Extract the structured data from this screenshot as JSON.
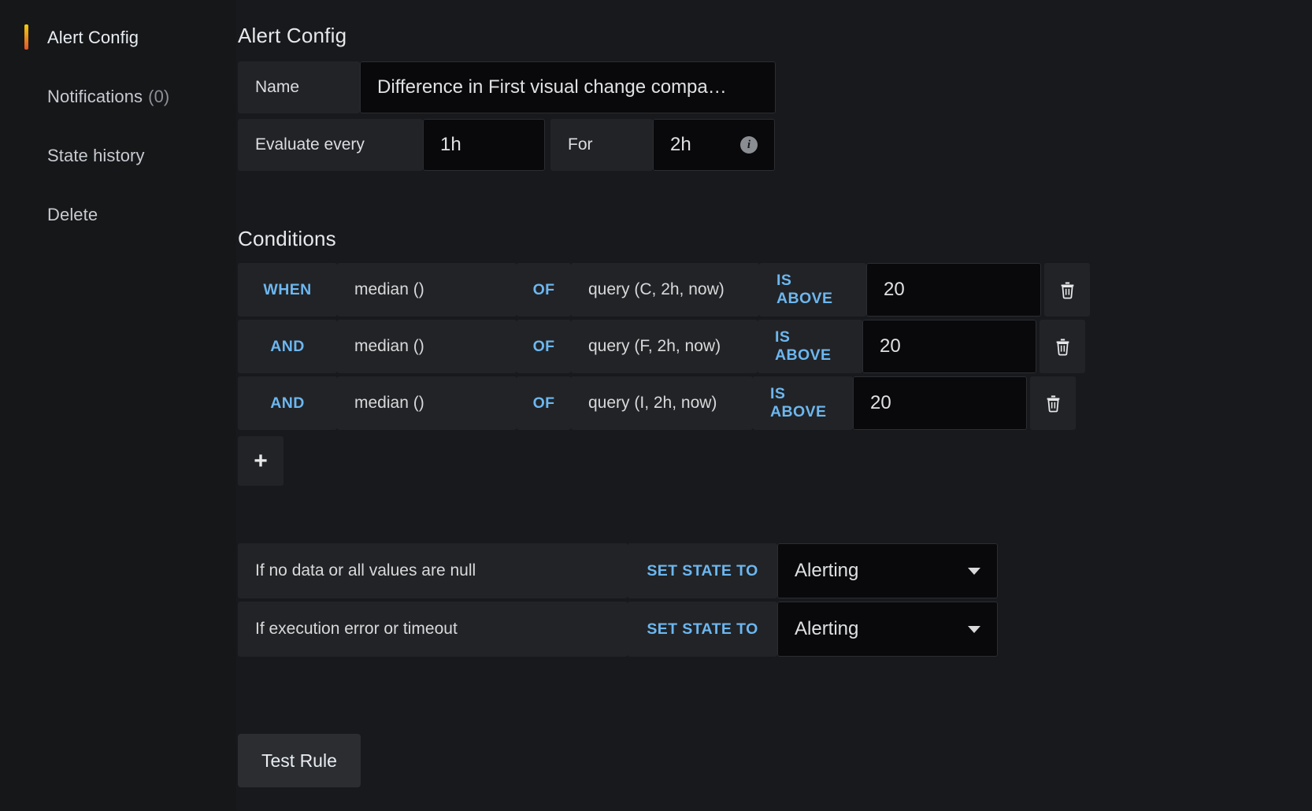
{
  "sidebar": {
    "items": [
      {
        "label": "Alert Config",
        "count": "",
        "active": true
      },
      {
        "label": "Notifications",
        "count": "(0)",
        "active": false
      },
      {
        "label": "State history",
        "count": "",
        "active": false
      },
      {
        "label": "Delete",
        "count": "",
        "active": false
      }
    ]
  },
  "alert_config": {
    "title": "Alert Config",
    "name_label": "Name",
    "name_value": "Difference in First visual change compa…",
    "evaluate_label": "Evaluate every",
    "evaluate_value": "1h",
    "for_label": "For",
    "for_value": "2h",
    "for_info_icon": "info-icon",
    "for_info_glyph": "i"
  },
  "conditions": {
    "title": "Conditions",
    "add_label": "+",
    "delete_icon": "trash-icon",
    "rows": [
      {
        "operator": "WHEN",
        "reducer": "median ()",
        "of": "OF",
        "query": "query (C, 2h, now)",
        "evaluator": "IS ABOVE",
        "value": "20"
      },
      {
        "operator": "AND",
        "reducer": "median ()",
        "of": "OF",
        "query": "query (F, 2h, now)",
        "evaluator": "IS ABOVE",
        "value": "20"
      },
      {
        "operator": "AND",
        "reducer": "median ()",
        "of": "OF",
        "query": "query (I, 2h, now)",
        "evaluator": "IS ABOVE",
        "value": "20"
      }
    ]
  },
  "handlers": {
    "no_data": {
      "text": "If no data or all values are null",
      "set_state_label": "SET STATE TO",
      "state": "Alerting",
      "caret_icon": "chevron-down-icon"
    },
    "exec_error": {
      "text": "If execution error or timeout",
      "set_state_label": "SET STATE TO",
      "state": "Alerting",
      "caret_icon": "chevron-down-icon"
    }
  },
  "actions": {
    "test_rule": "Test Rule"
  },
  "colors": {
    "accent_blue": "#6cb7f0",
    "active_bar_top": "#f2cc0c",
    "active_bar_bottom": "#e0552b",
    "panel_bg": "#18191c",
    "segment_bg": "#222326",
    "input_bg": "#09090b"
  }
}
